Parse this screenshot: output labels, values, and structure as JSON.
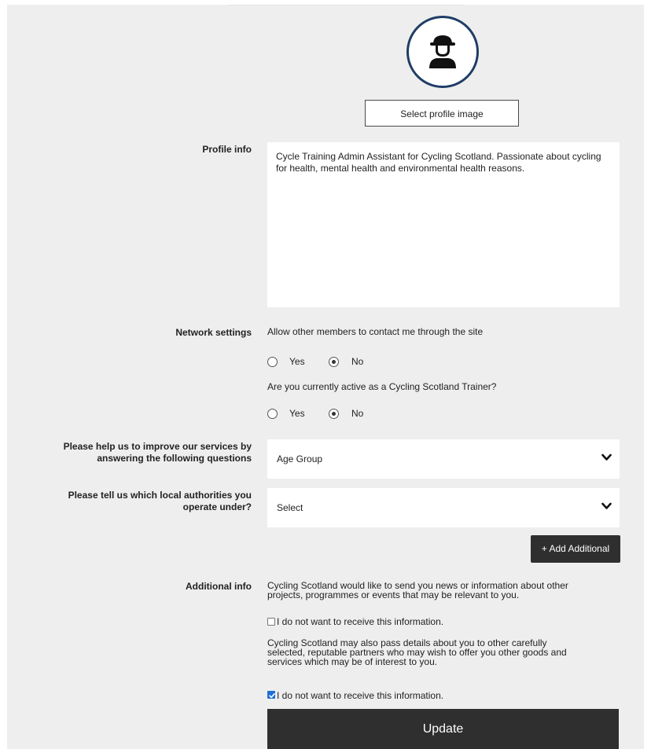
{
  "profile": {
    "avatar_icon": "user-avatar-icon",
    "select_image_label": "Select profile image"
  },
  "profile_info": {
    "label": "Profile info",
    "text": "Cycle Training Admin Assistant for Cycling Scotland.  Passionate about cycling for health, mental health and environmental health reasons."
  },
  "network": {
    "label": "Network settings",
    "q1": "Allow other members to contact me through the site",
    "q1_yes": "Yes",
    "q1_no": "No",
    "q1_selected": "No",
    "q2": "Are you currently active as a Cycling Scotland Trainer?",
    "q2_yes": "Yes",
    "q2_no": "No",
    "q2_selected": "No"
  },
  "services": {
    "label_line1": "Please help us to improve our services by",
    "label_line2": "answering the following questions",
    "select_value": "Age Group"
  },
  "authorities": {
    "label_line1": "Please tell us which local authorities you",
    "label_line2": "operate under?",
    "select_value": "Select",
    "add_label": "+ Add Additional"
  },
  "additional": {
    "label": "Additional info",
    "p1_line1": "Cycling Scotland would like to send you news or information about other",
    "p1_line2": "projects, programmes or events that may be relevant to you.",
    "opt_out1": "I do not want to receive this information.",
    "opt_out1_checked": false,
    "p2_line1": "Cycling Scotland may also pass details about you to other carefully",
    "p2_line2": "selected, reputable partners who may wish to offer you other goods and",
    "p2_line3": "services which may be of interest to you.",
    "opt_out2": "I do not want to receive this information.",
    "opt_out2_checked": true
  },
  "update_label": "Update",
  "colors": {
    "panel_bg": "#eeeeee",
    "avatar_ring": "#1f3d66",
    "dark_button": "#2f2f2f",
    "checkbox_checked": "#1e6fd6"
  }
}
